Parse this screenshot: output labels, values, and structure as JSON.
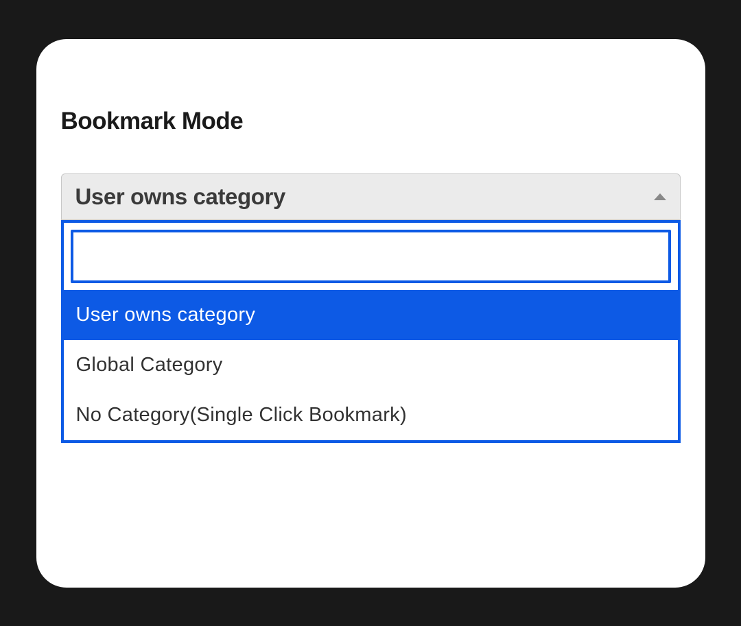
{
  "section": {
    "title": "Bookmark Mode"
  },
  "select": {
    "current": "User owns category",
    "search_value": "",
    "options": [
      {
        "label": "User owns category",
        "selected": true
      },
      {
        "label": "Global Category",
        "selected": false
      },
      {
        "label": "No Category(Single Click Bookmark)",
        "selected": false
      }
    ]
  },
  "colors": {
    "accent": "#0d5ae5",
    "background": "#191919",
    "card": "#ffffff",
    "trigger_bg": "#ebebeb"
  }
}
